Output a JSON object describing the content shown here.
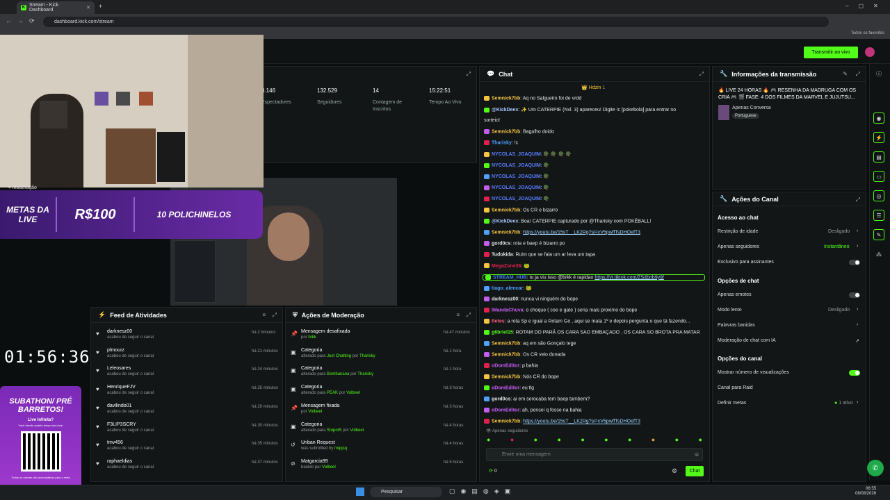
{
  "browser": {
    "tab_title": "Stream - Kick Dashboard",
    "url": "dashboard.kick.com/stream",
    "bookmarks_label": "Todos os favoritos"
  },
  "header": {
    "go_live": "Transmitir ao vivo"
  },
  "stats": [
    {
      "value": "3.146",
      "label": "Espectadores"
    },
    {
      "value": "132.529",
      "label": "Seguidores"
    },
    {
      "value": "14",
      "label": "Contagem de Inscritos"
    },
    {
      "value": "15:22:51",
      "label": "Tempo Ao Vivo"
    }
  ],
  "overlay": {
    "moderation_label": "Moderação",
    "metas_title": "METAS DA LIVE",
    "metas_value": "R$100",
    "metas_goal": "10 POLICHINELOS",
    "timer": "01:56:36",
    "promo_title": "SUBATHON/ PRÉ BARRETOS!",
    "promo_sub": "Live Infinita?",
    "promo_small": "Você decide quanto tempo ela dura!",
    "promo_footer": "Todos os valores são acumulativos para a meta"
  },
  "feed": {
    "title": "Feed de Atividades",
    "items": [
      {
        "name": "darknesz00",
        "sub": "acabou de seguir o canal",
        "time": "há 2 minutos"
      },
      {
        "name": "plmourz",
        "sub": "acabou de seguir o canal",
        "time": "há 21 minutos"
      },
      {
        "name": "Leleosares",
        "sub": "acabou de seguir o canal",
        "time": "há 24 minutos"
      },
      {
        "name": "HenriqueFJV",
        "sub": "acabou de seguir o canal",
        "time": "há 25 minutos"
      },
      {
        "name": "davilindo01",
        "sub": "acabou de seguir o canal",
        "time": "há 29 minutos"
      },
      {
        "name": "F3LIP3SCRY",
        "sub": "acabou de seguir o canal",
        "time": "há 30 minutos"
      },
      {
        "name": "tmv456",
        "sub": "acabou de seguir o canal",
        "time": "há 35 minutos"
      },
      {
        "name": "raphaeldias",
        "sub": "acabou de seguir o canal",
        "time": "há 37 minutos"
      }
    ]
  },
  "modactions": {
    "title": "Ações de Moderação",
    "items": [
      {
        "title": "Mensagem desafixada",
        "pre": "por",
        "who": "brkk",
        "post": "",
        "by": "",
        "time": "há 47 minutos"
      },
      {
        "title": "Categoria",
        "pre": "alterado para",
        "who": "Just Chatting",
        "post": "por",
        "by": "Tharisky",
        "time": "há 1 hora"
      },
      {
        "title": "Categoria",
        "pre": "alterado para",
        "who": "Bombanana",
        "post": "por",
        "by": "Tharisky",
        "time": "há 1 hora"
      },
      {
        "title": "Categoria",
        "pre": "alterado para",
        "who": "PEAK",
        "post": "por",
        "by": "Volbeel",
        "time": "há 3 horas"
      },
      {
        "title": "Mensagem fixada",
        "pre": "por",
        "who": "Volbeel",
        "post": "",
        "by": "",
        "time": "há 3 horas"
      },
      {
        "title": "Categoria",
        "pre": "alterado para",
        "who": "StopotS",
        "post": "por",
        "by": "Volbeel",
        "time": "há 4 horas"
      },
      {
        "title": "Unban Request",
        "pre": "was submitted by",
        "who": "mqqsq",
        "post": "",
        "by": "",
        "time": "há 4 horas"
      },
      {
        "title": "Matgarcia99",
        "pre": "banido por",
        "who": "Volbeel",
        "post": "",
        "by": "",
        "time": "há 5 horas"
      }
    ]
  },
  "chat": {
    "title": "Chat",
    "pinned": "Hdzin",
    "messages": [
      {
        "user": "Semnick7bb",
        "color": "#f5c542",
        "text": "Aq no Salgueiro foi de vrdd"
      },
      {
        "user": "@KickDeex",
        "color": "#a9c7ff",
        "text": "✨ Um CATERPIE (Nvl. 3) apareceu! Digite !c [pokebola] para entrar no"
      },
      {
        "user": "",
        "color": "#fff",
        "text": "sorteio!"
      },
      {
        "user": "Semnick7bb",
        "color": "#f5c542",
        "text": "Bagulho doido"
      },
      {
        "user": "Tharisky",
        "color": "#4ea1ff",
        "text": "!c"
      },
      {
        "user": "NYCOLAS_JOAQUIM",
        "color": "#5a7cff",
        "text": "🪖 🪖 🪖 🪖"
      },
      {
        "user": "NYCOLAS_JOAQUIM",
        "color": "#5a7cff",
        "text": "🪖"
      },
      {
        "user": "NYCOLAS_JOAQUIM",
        "color": "#5a7cff",
        "text": "🪖"
      },
      {
        "user": "NYCOLAS_JOAQUIM",
        "color": "#5a7cff",
        "text": "🪖"
      },
      {
        "user": "NYCOLAS_JOAQUIM",
        "color": "#5a7cff",
        "text": "🪖"
      },
      {
        "user": "Semnick7bb",
        "color": "#f5c542",
        "text": "Os CR e bizarro"
      },
      {
        "user": "@KickDeex",
        "color": "#a9c7ff",
        "text": "Boa! CATERPIE capturado por @Tharisky com POKÉBALL!"
      },
      {
        "user": "Semnick7bb",
        "color": "#f5c542",
        "text": "",
        "link": "https://youtu.be/15sT__LK2Rg?si=cV5pwffTsDHOefT3"
      },
      {
        "user": "gord0cs",
        "color": "#e6e6e6",
        "text": "rota e baep é bizarro po"
      },
      {
        "user": "Tudokida",
        "color": "#e6e6e6",
        "text": "Ruim que se fala um ar leva um tapa"
      },
      {
        "user": "MegaZone26",
        "color": "#e0214d",
        "text": "🐸"
      },
      {
        "user": "STREAM_HUB",
        "color": "#3b82f6",
        "text": "tu ja viu isso @brkk é rapidao",
        "link": "https://vt.tiktok.com/ZS4bnb9y9/"
      },
      {
        "user": "tiago_alencar",
        "color": "#4ea1ff",
        "text": "🐸"
      },
      {
        "user": "darknesz00",
        "color": "#e6e6e6",
        "text": "nunca vi ninguém do bope"
      },
      {
        "user": "IMandaChuva",
        "color": "#c45cf0",
        "text": "o choque ( coe e gate ) seria mais proximo do bope"
      },
      {
        "user": "ttetes",
        "color": "#ff5f7e",
        "text": "a rota Sp e igual a Rotam Go , aqui se mata 1º e depois pergunta o que tá fazendo..."
      },
      {
        "user": "g6briel15",
        "color": "#53fc18",
        "text": "ROTAM DO PARÁ OS CARA SAO EMBAÇADO , OS CARA SO BROTA PRA MATAR"
      },
      {
        "user": "Semnick7bb",
        "color": "#f5c542",
        "text": "aq em são Gonçalo tege"
      },
      {
        "user": "Semnick7bb",
        "color": "#f5c542",
        "text": "Os CR veio dunada"
      },
      {
        "user": "oDomEditor",
        "color": "#c45cf0",
        "text": "p bahia"
      },
      {
        "user": "Semnick7bb",
        "color": "#f5c542",
        "text": "Nós CR do bope"
      },
      {
        "user": "oDomEditor",
        "color": "#c45cf0",
        "text": "eu tlg"
      },
      {
        "user": "gord0cs",
        "color": "#e6e6e6",
        "text": "ai em sorocaba tem baep tambem?"
      },
      {
        "user": "oDomEditor",
        "color": "#c45cf0",
        "text": "ah, pensei q fosse na bahia"
      },
      {
        "user": "Semnick7bb",
        "color": "#f5c542",
        "text": "",
        "link": "https://youtu.be/15sT__LK2Rg?si=cV5pwffTsDHOefT3"
      }
    ],
    "followers_only": "Apenas seguidores",
    "input_placeholder": "Envie uma mensagem",
    "count": "0",
    "send": "Chat"
  },
  "streaminfo": {
    "title": "Informações da transmissão",
    "stream_title": "🔥 LIVE 24 HORAS 🔥 🎮 RESENHA DA MADRUGA COM OS CRIA 🎮 🎬 FASE: 4 DOS FILMES DA MARVEL E JUJUTSU...",
    "category": "Apenas Conversa",
    "language": "Portuguese"
  },
  "actions": {
    "title": "Ações do Canal",
    "chat_access": "Acesso ao chat",
    "age": "Restrição de idade",
    "age_val": "Desligado",
    "followers": "Apenas seguidores",
    "followers_val": "Instantâneo",
    "subs": "Exclusivo para assinantes",
    "chat_opts": "Opções de chat",
    "emotes": "Apenas emotes",
    "slow": "Modo lento",
    "slow_val": "Desligado",
    "banned": "Palavras banidas",
    "ai": "Moderação de chat com IA",
    "channel_opts": "Opções do canal",
    "viewers": "Mostrar número de visualizações",
    "raid": "Canal para Raid",
    "goals": "Definir metas",
    "goals_val": "1 ativo"
  },
  "taskbar": {
    "search": "Pesquisar",
    "time": "06:55",
    "date": "08/08/2026"
  },
  "colors": {
    "accent": "#53fc18",
    "bg": "#0b0e0f",
    "panel": "#121617"
  }
}
